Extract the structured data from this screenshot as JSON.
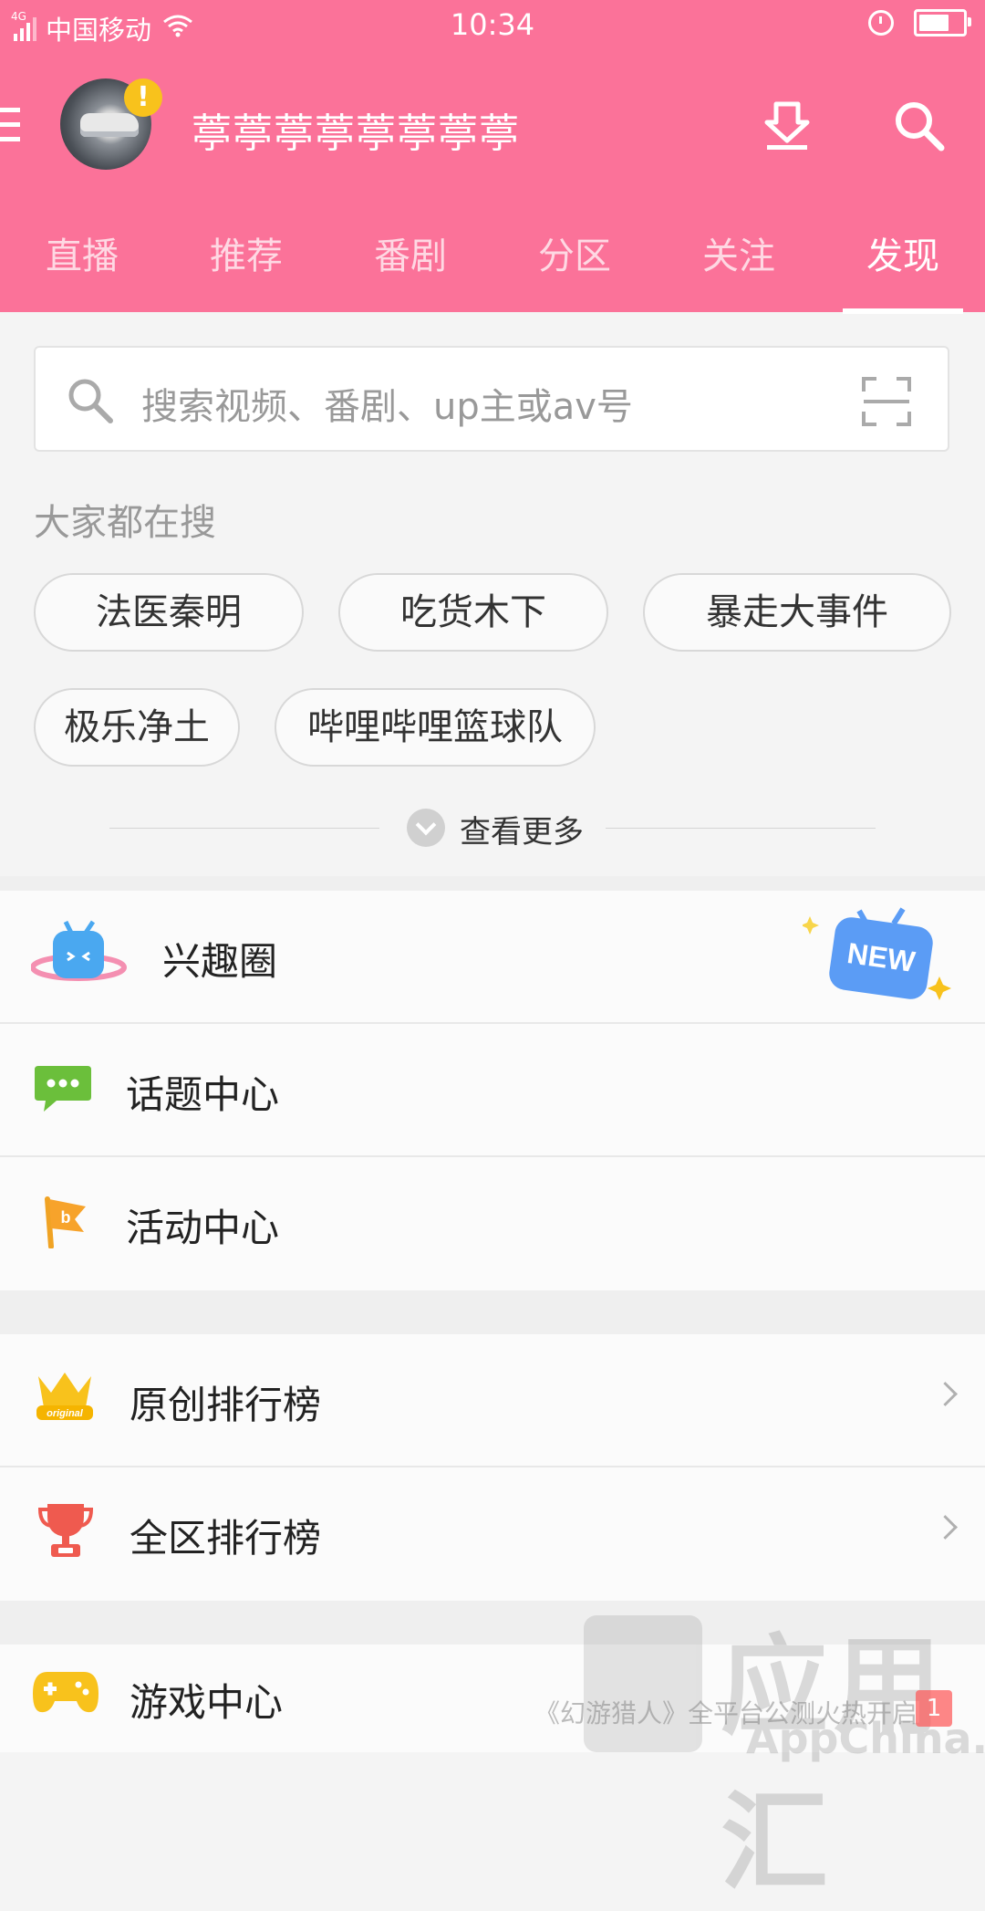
{
  "status_bar": {
    "network_tag": "4G",
    "carrier": "中国移动",
    "time": "10:34"
  },
  "header": {
    "username": "葶葶葶葶葶葶葶葶",
    "tabs": [
      {
        "label": "直播"
      },
      {
        "label": "推荐"
      },
      {
        "label": "番剧"
      },
      {
        "label": "分区"
      },
      {
        "label": "关注"
      },
      {
        "label": "发现",
        "active": true
      }
    ]
  },
  "search": {
    "placeholder": "搜索视频、番剧、up主或av号",
    "hot_title": "大家都在搜",
    "hot_tags": [
      "法医秦明",
      "吃货木下",
      "暴走大事件",
      "极乐净土",
      "哔哩哔哩篮球队"
    ],
    "more_label": "查看更多"
  },
  "menu": {
    "section1": [
      {
        "label": "兴趣圈",
        "icon": "interest-circle-icon",
        "badge": "NEW"
      },
      {
        "label": "话题中心",
        "icon": "chat-bubble-icon"
      },
      {
        "label": "活动中心",
        "icon": "flag-icon"
      }
    ],
    "section2": [
      {
        "label": "原创排行榜",
        "icon": "crown-icon",
        "icon_text": "original"
      },
      {
        "label": "全区排行榜",
        "icon": "trophy-icon"
      }
    ],
    "section3": [
      {
        "label": "游戏中心",
        "icon": "gamepad-icon"
      }
    ]
  },
  "overlay": {
    "watermark_text": "应用汇",
    "watermark_sub": "AppChina.com",
    "ticker_text": "《幻游猎人》全平台公测火热开启",
    "ticker_badge": "1"
  },
  "colors": {
    "brand_pink": "#fb7299",
    "new_badge_blue": "#5b9cf5",
    "gold": "#f8c21c"
  }
}
